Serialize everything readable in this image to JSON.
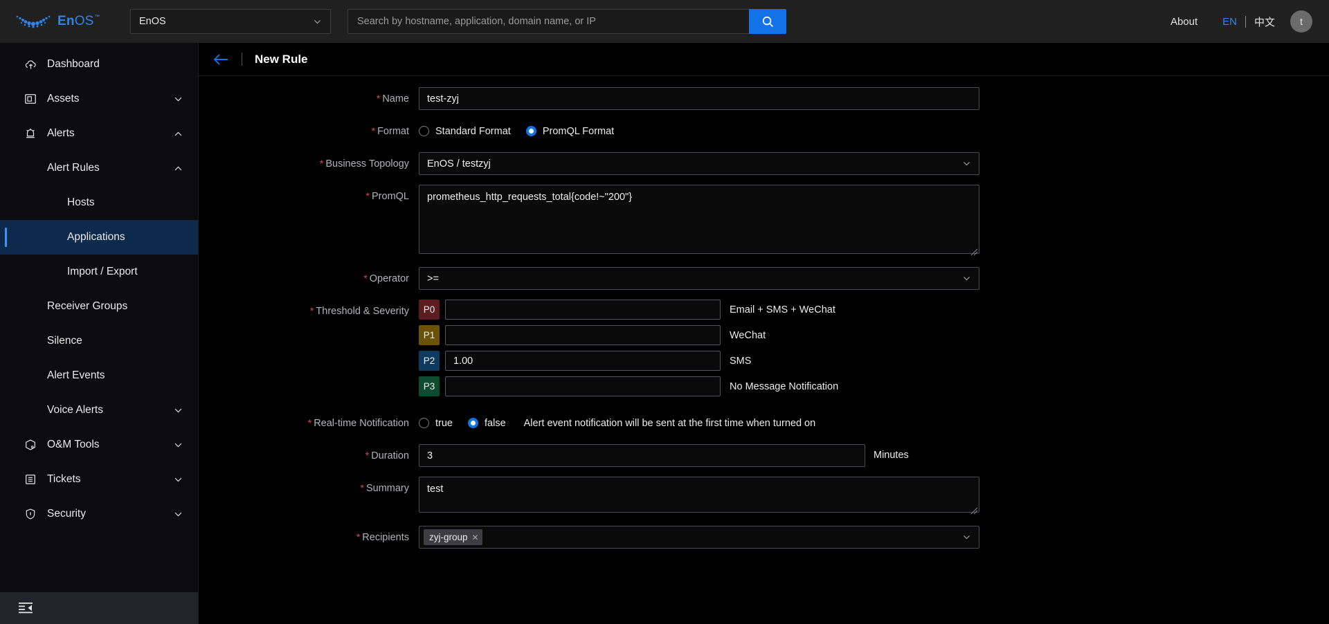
{
  "header": {
    "brand": {
      "text_bold": "En",
      "text_light": "OS",
      "tm": "™",
      "logo_icon": "enos-dots-logo"
    },
    "app_selector": {
      "value": "EnOS",
      "icon": "chevron-down-icon"
    },
    "search": {
      "placeholder": "Search by hostname, application, domain name, or IP",
      "value": "",
      "button_icon": "search-icon"
    },
    "about_label": "About",
    "lang_en": "EN",
    "lang_cn": "中文",
    "avatar_initial": "t"
  },
  "sidebar": {
    "items": [
      {
        "label": "Dashboard",
        "icon": "dashboard-cloud-icon",
        "level": 1,
        "arrow": "",
        "active": false
      },
      {
        "label": "Assets",
        "icon": "assets-icon",
        "level": 1,
        "arrow": "chevron-down-icon",
        "active": false
      },
      {
        "label": "Alerts",
        "icon": "alerts-bell-icon",
        "level": 1,
        "arrow": "chevron-up-icon",
        "active": false
      },
      {
        "label": "Alert Rules",
        "icon": "",
        "level": 2,
        "arrow": "chevron-up-icon",
        "active": false
      },
      {
        "label": "Hosts",
        "icon": "",
        "level": 3,
        "arrow": "",
        "active": false
      },
      {
        "label": "Applications",
        "icon": "",
        "level": 3,
        "arrow": "",
        "active": true
      },
      {
        "label": "Import / Export",
        "icon": "",
        "level": 3,
        "arrow": "",
        "active": false
      },
      {
        "label": "Receiver Groups",
        "icon": "",
        "level": 2,
        "arrow": "",
        "active": false
      },
      {
        "label": "Silence",
        "icon": "",
        "level": 2,
        "arrow": "",
        "active": false
      },
      {
        "label": "Alert Events",
        "icon": "",
        "level": 2,
        "arrow": "",
        "active": false
      },
      {
        "label": "Voice Alerts",
        "icon": "",
        "level": 2,
        "arrow": "chevron-down-icon",
        "active": false
      },
      {
        "label": "O&M Tools",
        "icon": "tools-box-icon",
        "level": 1,
        "arrow": "chevron-down-icon",
        "active": false
      },
      {
        "label": "Tickets",
        "icon": "tickets-icon",
        "level": 1,
        "arrow": "chevron-down-icon",
        "active": false
      },
      {
        "label": "Security",
        "icon": "shield-icon",
        "level": 1,
        "arrow": "chevron-down-icon",
        "active": false
      }
    ],
    "footer_icon": "menu-fold-icon"
  },
  "page": {
    "back_icon": "arrow-left-icon",
    "title": "New Rule"
  },
  "form": {
    "name": {
      "label": "Name",
      "required": true,
      "value": "test-zyj"
    },
    "format": {
      "label": "Format",
      "required": true,
      "options": [
        {
          "label": "Standard Format",
          "selected": false
        },
        {
          "label": "PromQL Format",
          "selected": true
        }
      ]
    },
    "business_topology": {
      "label": "Business Topology",
      "required": true,
      "value": "EnOS / testzyj",
      "icon": "chevron-down-icon"
    },
    "promql": {
      "label": "PromQL",
      "required": true,
      "value": "prometheus_http_requests_total{code!~\"200\"}"
    },
    "operator": {
      "label": "Operator",
      "required": true,
      "value": ">=",
      "icon": "chevron-down-icon"
    },
    "threshold": {
      "label": "Threshold & Severity",
      "required": true,
      "levels": [
        {
          "badge": "P0",
          "color": "#5c1c20",
          "value": "",
          "note": "Email + SMS + WeChat"
        },
        {
          "badge": "P1",
          "color": "#6b5208",
          "value": "",
          "note": "WeChat"
        },
        {
          "badge": "P2",
          "color": "#0f3a60",
          "value": "1.00",
          "note": "SMS"
        },
        {
          "badge": "P3",
          "color": "#0d4c2f",
          "value": "",
          "note": "No Message Notification"
        }
      ]
    },
    "realtime": {
      "label": "Real-time Notification",
      "required": true,
      "options": [
        {
          "label": "true",
          "selected": false
        },
        {
          "label": "false",
          "selected": true
        }
      ],
      "hint": "Alert event notification will be sent at the first time when turned on"
    },
    "duration": {
      "label": "Duration",
      "required": true,
      "value": "3",
      "unit": "Minutes"
    },
    "summary": {
      "label": "Summary",
      "required": true,
      "value": "test"
    },
    "recipients": {
      "label": "Recipients",
      "required": true,
      "tags": [
        "zyj-group"
      ],
      "remove_icon": "close-icon",
      "icon": "chevron-down-icon"
    }
  },
  "colors": {
    "accent": "#1373e6",
    "required": "#d9484f",
    "active_nav_bg": "#0d2a4d"
  }
}
